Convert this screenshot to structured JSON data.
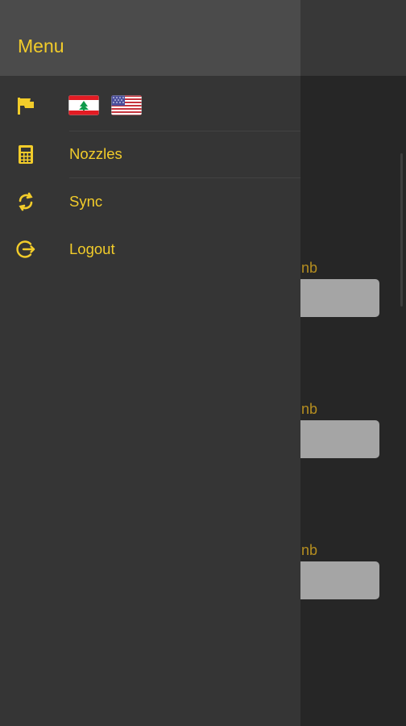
{
  "background": {
    "field_labels": [
      "nb",
      "nb",
      "nb"
    ]
  },
  "drawer": {
    "title": "Menu",
    "language_icon": "flag-icon",
    "flags": [
      "lebanon-flag-icon",
      "usa-flag-icon"
    ],
    "items": [
      {
        "label": "Nozzles",
        "icon": "calculator-icon"
      },
      {
        "label": "Sync",
        "icon": "sync-icon"
      },
      {
        "label": "Logout",
        "icon": "logout-icon"
      }
    ]
  },
  "colors": {
    "accent": "#f2cc2a",
    "drawer_bg": "#353535",
    "drawer_header_bg": "#4b4b4b"
  }
}
